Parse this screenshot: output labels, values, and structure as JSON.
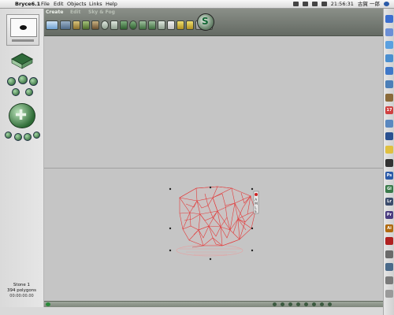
{
  "menubar": {
    "apple_glyph": "",
    "app_name": "Bryce6.1",
    "items": [
      "File",
      "Edit",
      "Objects",
      "Links",
      "Help"
    ],
    "clock": "21:56:31",
    "user": "古賀 一郎"
  },
  "toolbar": {
    "tabs": [
      "Create",
      "Edit",
      "Sky & Fog"
    ],
    "render_glyph": "S"
  },
  "left_panel": {
    "object_name": "Stone 1",
    "polygon_count": "394 polygons",
    "timecode": "00:00:00.00"
  },
  "gizmo": {
    "labels": [
      "A",
      "M",
      "L",
      "E"
    ]
  },
  "dock": {
    "icons": [
      {
        "name": "finder-icon",
        "color": "#3b6fd0",
        "glyph": ""
      },
      {
        "name": "mail-icon",
        "color": "#6b8fd6",
        "glyph": ""
      },
      {
        "name": "safari-icon",
        "color": "#5aa0e0",
        "glyph": ""
      },
      {
        "name": "ichat-icon",
        "color": "#4a8fd0",
        "glyph": ""
      },
      {
        "name": "itunes-icon",
        "color": "#3f78c8",
        "glyph": ""
      },
      {
        "name": "iphoto-icon",
        "color": "#4c7fb8",
        "glyph": ""
      },
      {
        "name": "address-icon",
        "color": "#8a6a3a",
        "glyph": ""
      },
      {
        "name": "calendar-icon",
        "color": "#d04040",
        "glyph": "17"
      },
      {
        "name": "preview-icon",
        "color": "#5a88c0",
        "glyph": ""
      },
      {
        "name": "dashboard-icon",
        "color": "#2a5090",
        "glyph": ""
      },
      {
        "name": "stickies-icon",
        "color": "#e0c040",
        "glyph": ""
      },
      {
        "name": "terminal-icon",
        "color": "#333333",
        "glyph": ""
      },
      {
        "name": "photoshop-icon",
        "color": "#2b5aa8",
        "glyph": "Ps"
      },
      {
        "name": "golive-icon",
        "color": "#3a7a4a",
        "glyph": "Gl"
      },
      {
        "name": "lightroom-icon",
        "color": "#3c4c6c",
        "glyph": "Lr"
      },
      {
        "name": "premiere-icon",
        "color": "#4a3c80",
        "glyph": "Pr"
      },
      {
        "name": "illustrator-icon",
        "color": "#b06a10",
        "glyph": "Ai"
      },
      {
        "name": "acrobat-icon",
        "color": "#b02020",
        "glyph": ""
      },
      {
        "name": "app-icon-1",
        "color": "#6a6a6a",
        "glyph": ""
      },
      {
        "name": "app-icon-2",
        "color": "#4a6a8a",
        "glyph": ""
      },
      {
        "name": "app-icon-3",
        "color": "#7a7a7a",
        "glyph": ""
      },
      {
        "name": "trash-icon",
        "color": "#9a9a9a",
        "glyph": ""
      }
    ]
  }
}
